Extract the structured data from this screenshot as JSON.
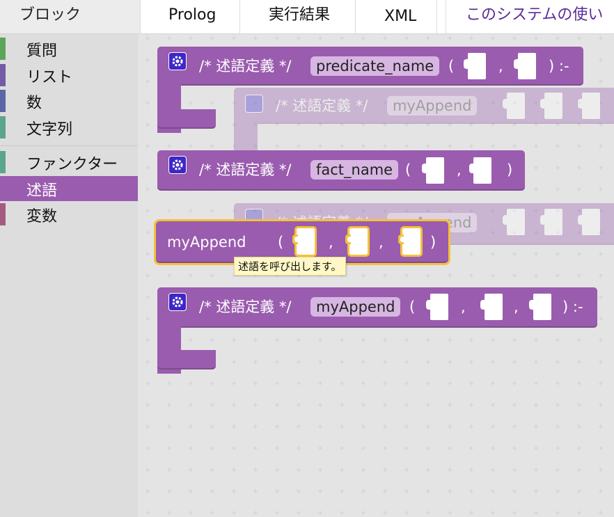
{
  "tabs": {
    "blocks": "ブロック",
    "prolog": "Prolog",
    "result": "実行結果",
    "xml": "XML",
    "howto": "このシステムの使い"
  },
  "toolbox": {
    "categories": [
      {
        "label": "質問",
        "color": "#5ba55b"
      },
      {
        "label": "リスト",
        "color": "#745ba5"
      },
      {
        "label": "数",
        "color": "#5b67a5"
      },
      {
        "label": "文字列",
        "color": "#5ba58c"
      },
      {
        "label": "ファンクター",
        "color": "#5ba58c"
      },
      {
        "label": "述語",
        "color": "#9a5cae"
      },
      {
        "label": "変数",
        "color": "#a55b80"
      }
    ]
  },
  "blocks": {
    "comment": "/* 述語定義 */",
    "lparen": "(",
    "rparen": ")",
    "comma": ",",
    "neck": ":-",
    "def1_name": "predicate_name",
    "ghost1_name": "myAppend",
    "fact_name": "fact_name",
    "ghost2_name": "myAppend",
    "call_name": "myAppend",
    "def2_name": "myAppend"
  },
  "tooltip": "述語を呼び出します。",
  "colors": {
    "predicate_block": "#9a5cae",
    "selected_outline": "#f5c13a",
    "gear_icon": "#3d27c6",
    "tooltip_bg": "#fff8c6"
  }
}
